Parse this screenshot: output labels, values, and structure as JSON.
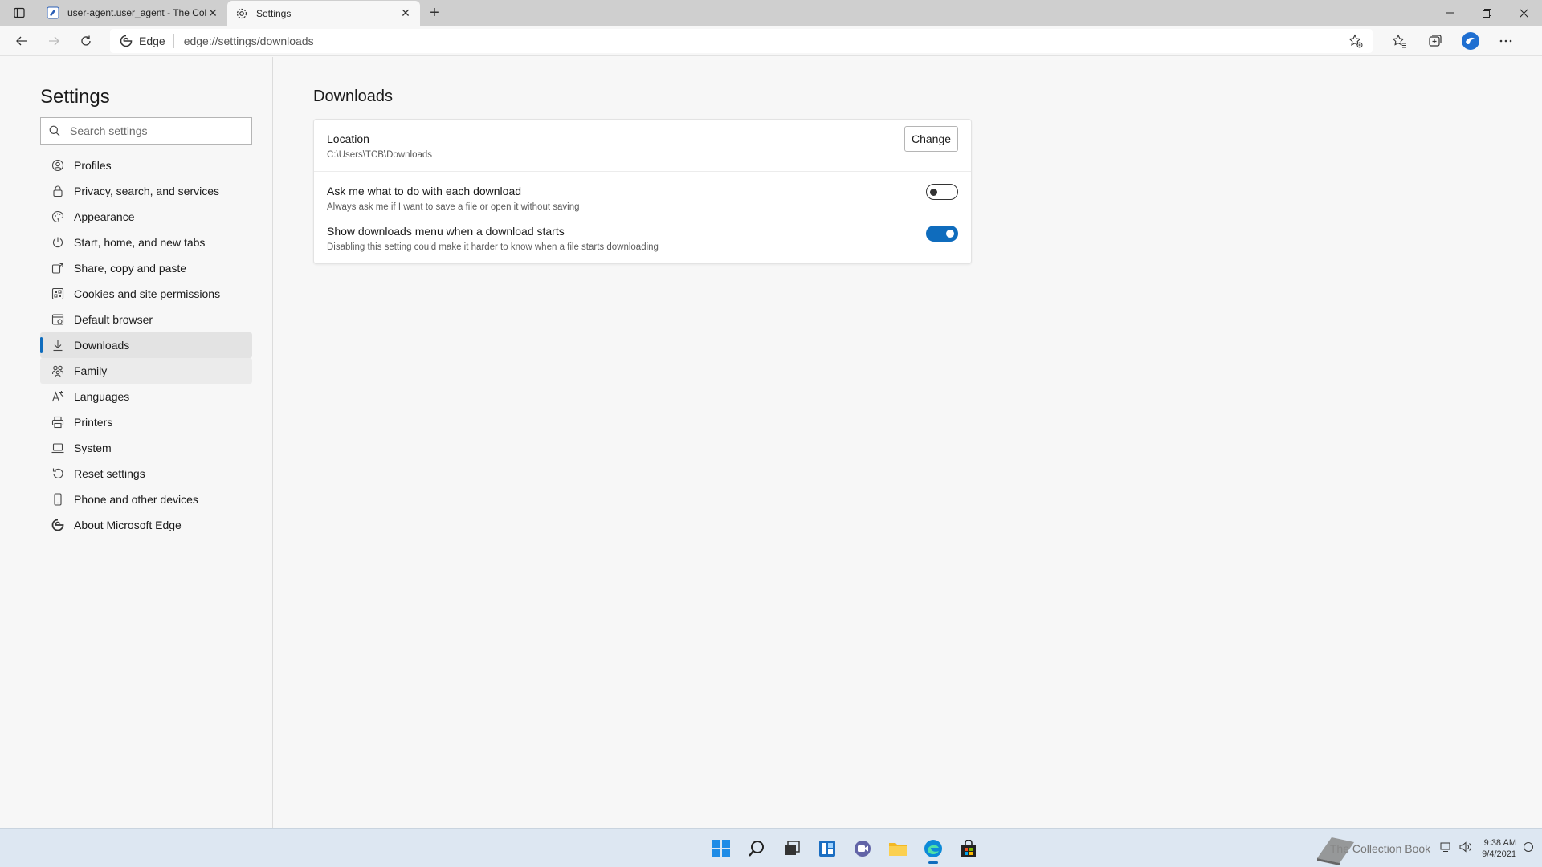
{
  "browser": {
    "tabs": [
      {
        "title": "user-agent.user_agent - The Coll",
        "active": false,
        "icon": "wiki-favicon-icon"
      },
      {
        "title": "Settings",
        "active": true,
        "icon": "gear-icon"
      }
    ],
    "new_tab_label": "+",
    "address": {
      "identity_label": "Edge",
      "url": "edge://settings/downloads"
    }
  },
  "sidebar": {
    "title": "Settings",
    "search_placeholder": "Search settings",
    "items": [
      {
        "label": "Profiles",
        "icon": "profile-icon"
      },
      {
        "label": "Privacy, search, and services",
        "icon": "lock-icon"
      },
      {
        "label": "Appearance",
        "icon": "palette-icon"
      },
      {
        "label": "Start, home, and new tabs",
        "icon": "power-icon"
      },
      {
        "label": "Share, copy and paste",
        "icon": "share-icon"
      },
      {
        "label": "Cookies and site permissions",
        "icon": "cookies-icon"
      },
      {
        "label": "Default browser",
        "icon": "browser-icon"
      },
      {
        "label": "Downloads",
        "icon": "download-icon",
        "selected": true
      },
      {
        "label": "Family",
        "icon": "family-icon"
      },
      {
        "label": "Languages",
        "icon": "language-icon"
      },
      {
        "label": "Printers",
        "icon": "printer-icon"
      },
      {
        "label": "System",
        "icon": "laptop-icon"
      },
      {
        "label": "Reset settings",
        "icon": "reset-icon"
      },
      {
        "label": "Phone and other devices",
        "icon": "phone-icon"
      },
      {
        "label": "About Microsoft Edge",
        "icon": "edge-logo-icon"
      }
    ]
  },
  "main": {
    "title": "Downloads",
    "location": {
      "title": "Location",
      "path": "C:\\Users\\TCB\\Downloads",
      "button": "Change"
    },
    "ask_setting": {
      "title": "Ask me what to do with each download",
      "desc": "Always ask me if I want to save a file or open it without saving",
      "enabled": false
    },
    "menu_setting": {
      "title": "Show downloads menu when a download starts",
      "desc": "Disabling this setting could make it harder to know when a file starts downloading",
      "enabled": true
    }
  },
  "taskbar": {
    "apps": [
      "windows-start-icon",
      "search-icon",
      "task-view-icon",
      "widgets-icon",
      "chat-icon",
      "file-explorer-icon",
      "edge-icon",
      "store-icon"
    ],
    "watermark_text": "The Collection Book",
    "time": "9:38 AM",
    "date": "9/4/2021"
  },
  "colors": {
    "accent": "#0f6cbd",
    "taskbar": "#dde7f2",
    "tabstrip": "#cfcfcf"
  }
}
